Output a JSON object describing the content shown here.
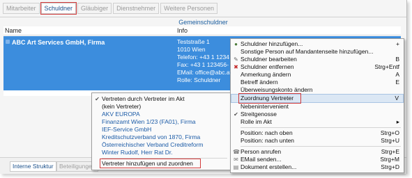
{
  "tabs": [
    {
      "label": "Mitarbeiter",
      "active": false
    },
    {
      "label": "Schuldner",
      "active": true
    },
    {
      "label": "Gläubiger",
      "active": false
    },
    {
      "label": "Dienstnehmer",
      "active": false
    },
    {
      "label": "Weitere Personen",
      "active": false
    }
  ],
  "group_caption": "Gemeinschuldner",
  "table": {
    "columns": [
      "Name",
      "Info"
    ],
    "row": {
      "name": "ABC Art Services GmbH, Firma",
      "info": [
        "Teststraße 1",
        "1010 Wien",
        "Telefon: +43 1 1234",
        "Fax: +43 1 123456-",
        "EMail: office@abc.at",
        "Rolle: Schuldner"
      ]
    }
  },
  "left_menu": {
    "items": [
      {
        "label": "Vertreten durch Vertreter im Akt",
        "checked": true
      },
      {
        "label": "(kein Vertreter)",
        "checked": false
      },
      {
        "label": "AKV EUROPA",
        "checked": false
      },
      {
        "label": "Finanzamt Wien 1/23 (FA01), Firma",
        "checked": false
      },
      {
        "label": "IEF-Service GmbH",
        "checked": false
      },
      {
        "label": "Kreditschutzverband von 1870, Firma",
        "checked": false
      },
      {
        "label": "Österreichischer Verband Creditreform",
        "checked": false
      },
      {
        "label": "Winter Rudolf, Herr Rat Dr.",
        "checked": false
      }
    ],
    "footer": "Vertreter hinzufügen und zuordnen"
  },
  "right_menu": {
    "items": [
      {
        "label": "Schuldner hinzufügen...",
        "shortcut": "+",
        "icon": "user-add-icon",
        "glyph": ""
      },
      {
        "label": "Sonstige Person auf Mandantenseite hinzufügen...",
        "shortcut": "",
        "icon": "",
        "glyph": ""
      },
      {
        "label": "Schuldner bearbeiten",
        "shortcut": "B",
        "icon": "edit-icon",
        "glyph": "✎"
      },
      {
        "label": "Schuldner entfernen",
        "shortcut": "Strg+Entf",
        "icon": "delete-icon",
        "glyph": "✖"
      },
      {
        "label": "Anmerkung ändern",
        "shortcut": "A",
        "icon": "",
        "glyph": ""
      },
      {
        "label": "Betreff ändern",
        "shortcut": "E",
        "icon": "",
        "glyph": ""
      },
      {
        "label": "Überweisungskonto ändern",
        "shortcut": "",
        "icon": "",
        "glyph": ""
      },
      {
        "label": "Zuordnung Vertreter",
        "shortcut": "V",
        "icon": "",
        "glyph": ""
      },
      {
        "label": "Nebenintervenient",
        "shortcut": "",
        "icon": "",
        "glyph": ""
      },
      {
        "label": "Streitgenosse",
        "shortcut": "",
        "icon": "check-icon",
        "glyph": "✔"
      },
      {
        "label": "Rolle im Akt",
        "shortcut": "▸",
        "icon": "",
        "glyph": ""
      },
      {
        "label": "Position: nach oben",
        "shortcut": "Strg+O",
        "icon": "",
        "glyph": ""
      },
      {
        "label": "Position: nach unten",
        "shortcut": "Strg+U",
        "icon": "",
        "glyph": ""
      },
      {
        "label": "Person anrufen",
        "shortcut": "Strg+E",
        "icon": "phone-icon",
        "glyph": "☎"
      },
      {
        "label": "EMail senden...",
        "shortcut": "Strg+M",
        "icon": "mail-icon",
        "glyph": "✉"
      },
      {
        "label": "Dokument erstellen...",
        "shortcut": "Strg+D",
        "icon": "document-icon",
        "glyph": "▤"
      }
    ]
  },
  "bottom_tabs": [
    {
      "label": "Interne Struktur",
      "active": true
    },
    {
      "label": "Beteiligungen",
      "active": false
    }
  ]
}
